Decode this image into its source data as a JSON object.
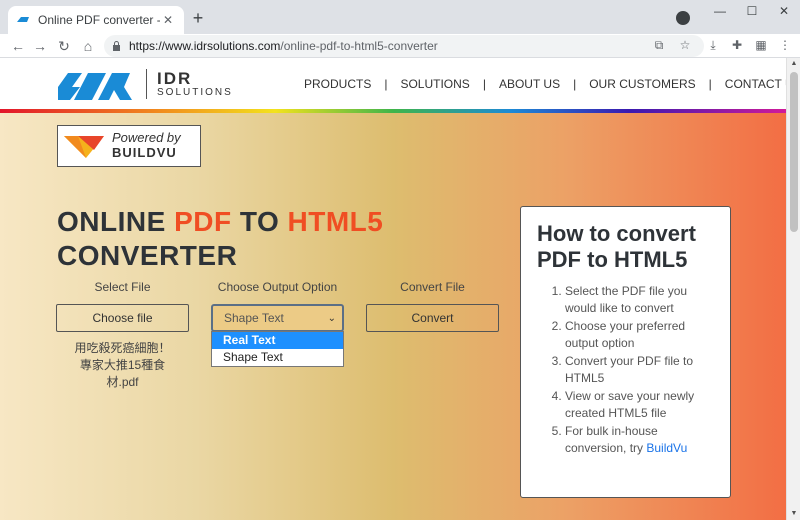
{
  "browser": {
    "tab_title": "Online PDF converter - PDF to",
    "tab_close": "✕",
    "new_tab": "+",
    "url_host": "https://www.idrsolutions.com",
    "url_path": "/online-pdf-to-html5-converter",
    "win_minimize": "—",
    "win_maximize": "☐",
    "win_close": "✕"
  },
  "site": {
    "logo_name": "IDR",
    "logo_subtitle": "SOLUTIONS",
    "nav": [
      "PRODUCTS",
      "SOLUTIONS",
      "ABOUT US",
      "OUR CUSTOMERS",
      "CONTACT US"
    ],
    "nav_separator": "|"
  },
  "powered_by": {
    "line1": "Powered by",
    "line2": "BUILDVU"
  },
  "headline": {
    "w1": "ONLINE ",
    "w2": "PDF",
    "w3": " TO ",
    "w4": "HTML5",
    "w5": "CONVERTER"
  },
  "converter": {
    "select_file_label": "Select File",
    "choose_file_button": "Choose file",
    "output_option_label": "Choose Output Option",
    "selected_option": "Shape Text",
    "options": [
      "Real Text",
      "Shape Text"
    ],
    "highlighted_option": "Real Text",
    "convert_label": "Convert File",
    "convert_button": "Convert",
    "filename_lines": [
      "用吃殺死癌細胞！",
      "專家大推15種食",
      "材.pdf"
    ]
  },
  "howto": {
    "title": "How to convert PDF to HTML5",
    "steps": [
      "Select the PDF file you would like to convert",
      "Choose your preferred output option",
      "Convert your PDF file to HTML5",
      "View or save your newly created HTML5 file",
      "For bulk in-house conversion, try "
    ],
    "step5_link": "BuildVu"
  },
  "colors": {
    "accent": "#f04e23",
    "heading": "#2e3338",
    "link": "#1a73e8",
    "dropdown_highlight": "#1e90ff"
  }
}
